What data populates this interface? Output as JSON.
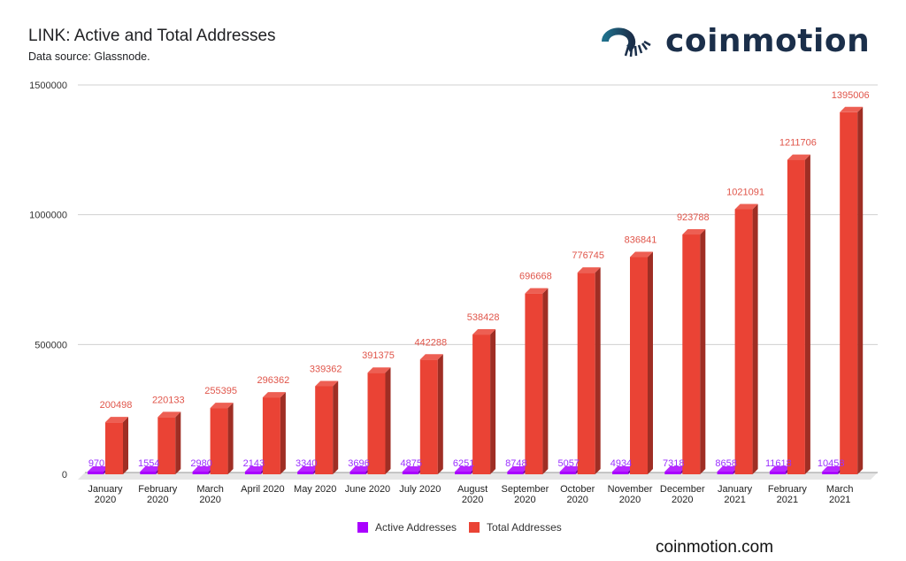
{
  "header": {
    "title": "LINK: Active and Total Addresses",
    "subtitle": "Data source: Glassnode."
  },
  "brand": {
    "logo_text": "coinmotion",
    "logo_icon": "coinmotion-swirl-icon",
    "footer_url": "coinmotion.com",
    "logo_color": "#1b2f4a"
  },
  "chart_data": {
    "type": "bar",
    "title": "LINK: Active and Total Addresses",
    "subtitle": "Data source: Glassnode.",
    "xlabel": "",
    "ylabel": "",
    "ylim": [
      0,
      1500000
    ],
    "yticks": [
      "0",
      "500000",
      "1000000",
      "1500000"
    ],
    "ytick_values": [
      0,
      500000,
      1000000,
      1500000
    ],
    "grid": true,
    "legend_position": "bottom",
    "categories": [
      [
        "January",
        "2020"
      ],
      [
        "February",
        "2020"
      ],
      [
        "March",
        "2020"
      ],
      [
        "April 2020"
      ],
      [
        "May 2020"
      ],
      [
        "June 2020"
      ],
      [
        "July 2020"
      ],
      [
        "August",
        "2020"
      ],
      [
        "September",
        "2020"
      ],
      [
        "October",
        "2020"
      ],
      [
        "November",
        "2020"
      ],
      [
        "December",
        "2020"
      ],
      [
        "January",
        "2021"
      ],
      [
        "February",
        "2021"
      ],
      [
        "March",
        "2021"
      ]
    ],
    "series": [
      {
        "name": "Active Addresses",
        "color": "#aa00ff",
        "label_color": "#9b30ff",
        "values": [
          970,
          1554,
          2980,
          2143,
          3340,
          3696,
          4875,
          6251,
          8748,
          5057,
          4934,
          7318,
          8658,
          11618,
          10458
        ]
      },
      {
        "name": "Total Addresses",
        "color": "#ea4335",
        "label_color": "#e0554a",
        "values": [
          200498,
          220133,
          255395,
          296362,
          339362,
          391375,
          442288,
          538428,
          696668,
          776745,
          836841,
          923788,
          1021091,
          1211706,
          1395006
        ]
      }
    ]
  }
}
